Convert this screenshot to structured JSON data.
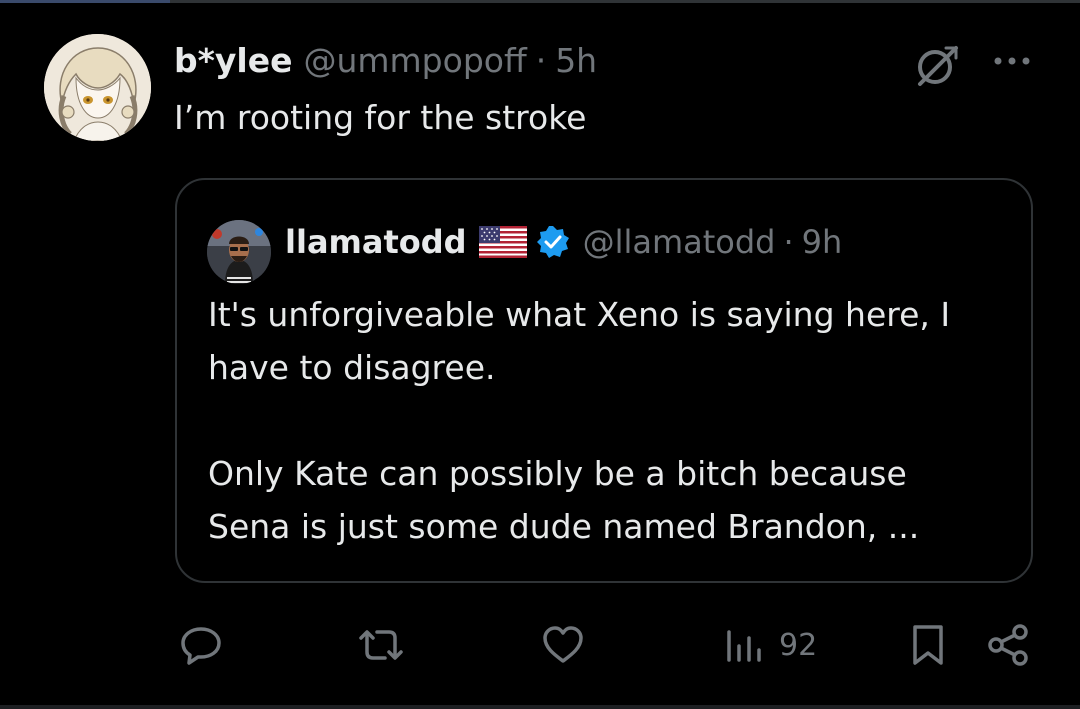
{
  "tweet": {
    "display_name": "b*ylee",
    "handle": "@ummpopoff",
    "separator": "·",
    "time": "5h",
    "text": "I’m rooting for the stroke"
  },
  "quoted_tweet": {
    "display_name": "llamatodd",
    "flag": "us-flag-icon",
    "verified": true,
    "handle": "@llamatodd",
    "separator": "·",
    "time": "9h",
    "paragraphs": [
      [
        "It's unforgiveable what Xeno is saying here, I",
        "have to disagree."
      ],
      [
        "Only Kate can possibly be a bitch because",
        "Sena is just some dude named Brandon, ..."
      ]
    ]
  },
  "actions": {
    "reply": "reply-icon",
    "retweet": "retweet-icon",
    "like": "heart-icon",
    "views": "views-icon",
    "views_count": "92",
    "bookmark": "bookmark-icon",
    "share": "share-icon"
  },
  "colors": {
    "background": "#000000",
    "text_primary": "#e7e9ea",
    "text_secondary": "#71767b",
    "border": "#2f3336",
    "verified": "#1d9bf0"
  }
}
